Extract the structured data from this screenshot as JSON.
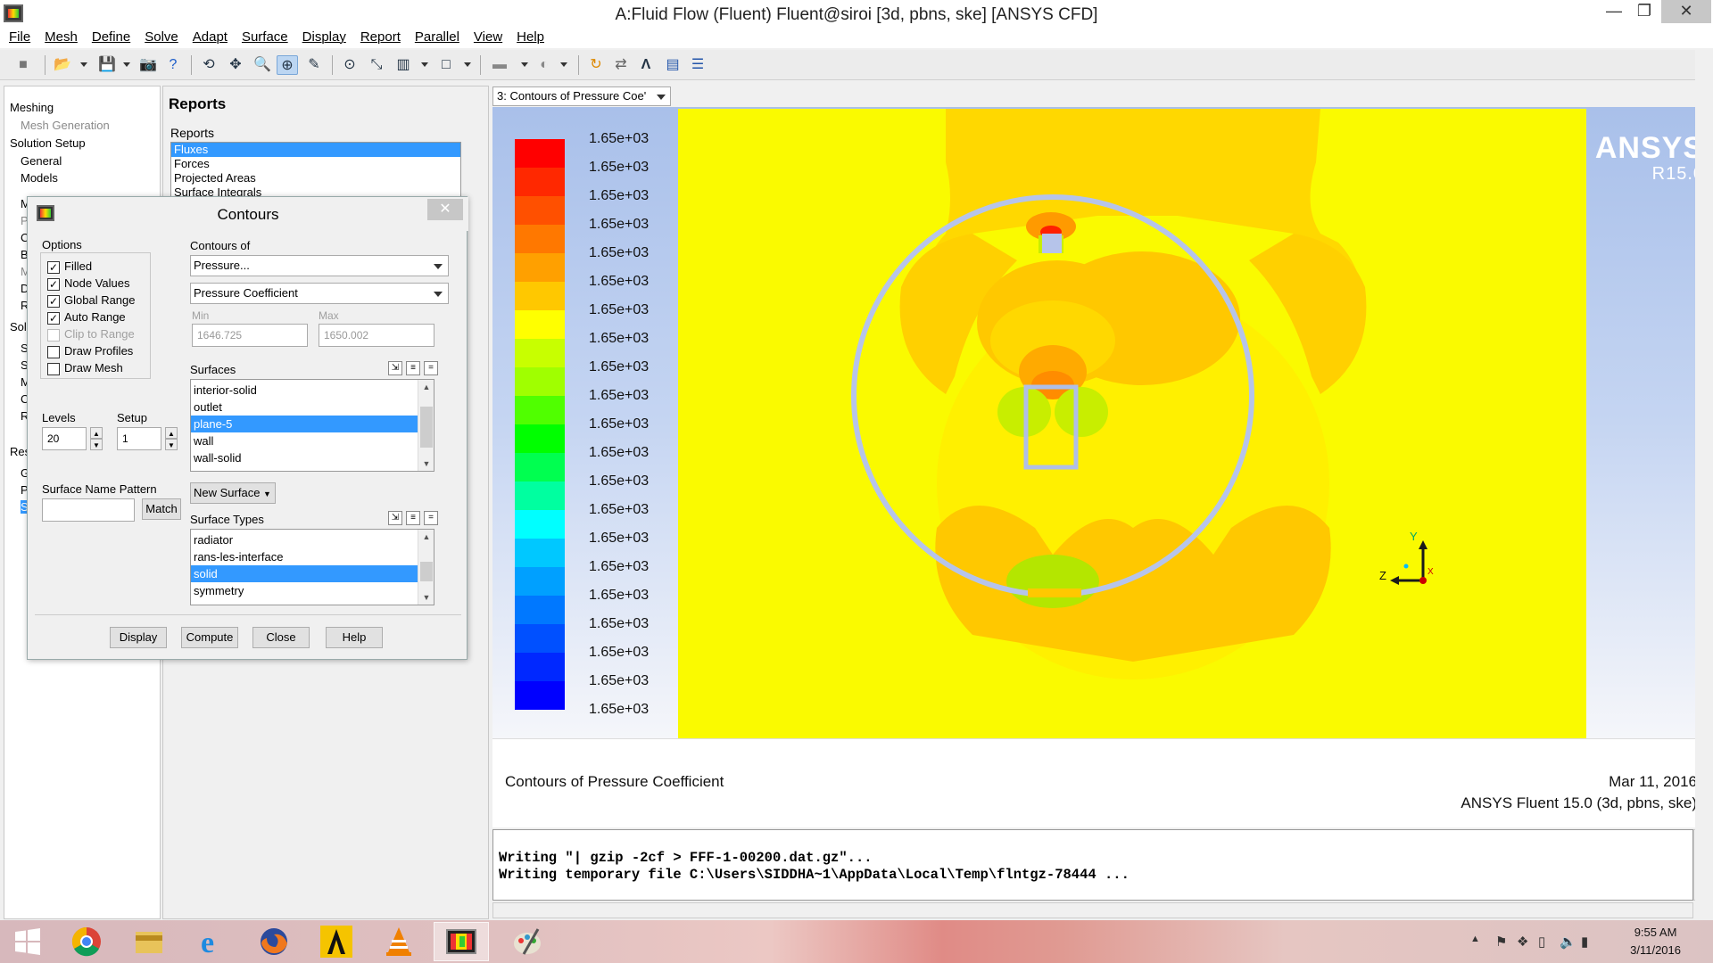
{
  "window": {
    "title": "A:Fluid Flow (Fluent) Fluent@siroi  [3d, pbns, ske] [ANSYS CFD]",
    "minimize": "—",
    "maximize": "❐",
    "close": "✕"
  },
  "menubar": [
    "File",
    "Mesh",
    "Define",
    "Solve",
    "Adapt",
    "Surface",
    "Display",
    "Report",
    "Parallel",
    "View",
    "Help"
  ],
  "tree": {
    "items": [
      "Meshing",
      "Mesh Generation",
      "Solution Setup",
      "General",
      "Models",
      "M",
      "P",
      "C",
      "B",
      "M",
      "D",
      "R",
      "Solu",
      "S",
      "S",
      "M",
      "C",
      "R",
      "Res",
      "G",
      "P",
      "S"
    ]
  },
  "task_panel": {
    "heading": "Reports",
    "reports_label": "Reports",
    "reports": [
      "Fluxes",
      "Forces",
      "Projected Areas",
      "Surface Integrals"
    ]
  },
  "dialog": {
    "title": "Contours",
    "close": "✕",
    "options_label": "Options",
    "options": [
      {
        "label": "Filled",
        "checked": true,
        "enabled": true
      },
      {
        "label": "Node Values",
        "checked": true,
        "enabled": true
      },
      {
        "label": "Global Range",
        "checked": true,
        "enabled": true
      },
      {
        "label": "Auto Range",
        "checked": true,
        "enabled": true
      },
      {
        "label": "Clip to Range",
        "checked": false,
        "enabled": false
      },
      {
        "label": "Draw Profiles",
        "checked": false,
        "enabled": true
      },
      {
        "label": "Draw Mesh",
        "checked": false,
        "enabled": true
      }
    ],
    "contours_of_label": "Contours of",
    "contours_of": "Pressure...",
    "contours_sub": "Pressure Coefficient",
    "min_label": "Min",
    "max_label": "Max",
    "min": "1646.725",
    "max": "1650.002",
    "surfaces_label": "Surfaces",
    "surfaces": [
      "interior-solid",
      "outlet",
      "plane-5",
      "wall",
      "wall-solid"
    ],
    "surfaces_selected": "plane-5",
    "levels_label": "Levels",
    "levels": "20",
    "setup_label": "Setup",
    "setup": "1",
    "pattern_label": "Surface Name Pattern",
    "pattern_value": "",
    "match": "Match",
    "new_surface": "New Surface",
    "surface_types_label": "Surface Types",
    "surface_types": [
      "radiator",
      "rans-les-interface",
      "solid",
      "symmetry"
    ],
    "surface_types_selected": "solid",
    "buttons": {
      "display": "Display",
      "compute": "Compute",
      "close": "Close",
      "help": "Help"
    }
  },
  "graphics": {
    "tab": "3: Contours of Pressure Coe'",
    "logo_name": "ANSYS",
    "logo_version": "R15.0",
    "footer_left": "Contours of Pressure Coefficient",
    "footer_date": "Mar 11, 2016",
    "footer_version": "ANSYS Fluent 15.0 (3d, pbns, ske)",
    "axis_y": "Y",
    "axis_z": "Z",
    "axis_x": "X"
  },
  "chart_data": {
    "type": "heatmap",
    "title": "Contours of Pressure Coefficient",
    "colorbar_labels": [
      "1.65e+03",
      "1.65e+03",
      "1.65e+03",
      "1.65e+03",
      "1.65e+03",
      "1.65e+03",
      "1.65e+03",
      "1.65e+03",
      "1.65e+03",
      "1.65e+03",
      "1.65e+03",
      "1.65e+03",
      "1.65e+03",
      "1.65e+03",
      "1.65e+03",
      "1.65e+03",
      "1.65e+03",
      "1.65e+03",
      "1.65e+03",
      "1.65e+03",
      "1.65e+03"
    ],
    "colorbar_colors": [
      "#ff0000",
      "#ff2800",
      "#ff5000",
      "#ff7800",
      "#ffa000",
      "#ffc800",
      "#ffff00",
      "#c8ff00",
      "#a0ff00",
      "#50ff00",
      "#00ff00",
      "#00ff50",
      "#00ffa0",
      "#00ffff",
      "#00c8ff",
      "#00a0ff",
      "#0078ff",
      "#0050ff",
      "#0028ff",
      "#0000ff"
    ],
    "range": [
      1646.725,
      1650.002
    ],
    "levels": 20
  },
  "console": {
    "lines": [
      "Writing \"| gzip -2cf > FFF-1-00200.dat.gz\"...",
      "Writing temporary file C:\\Users\\SIDDHA~1\\AppData\\Local\\Temp\\flntgz-78444 ..."
    ]
  },
  "taskbar": {
    "apps": [
      "start",
      "chrome",
      "file-explorer",
      "internet-explorer",
      "firefox",
      "ansys-workbench",
      "vlc",
      "fluent",
      "paint"
    ],
    "time": "9:55 AM",
    "date": "3/11/2016"
  }
}
